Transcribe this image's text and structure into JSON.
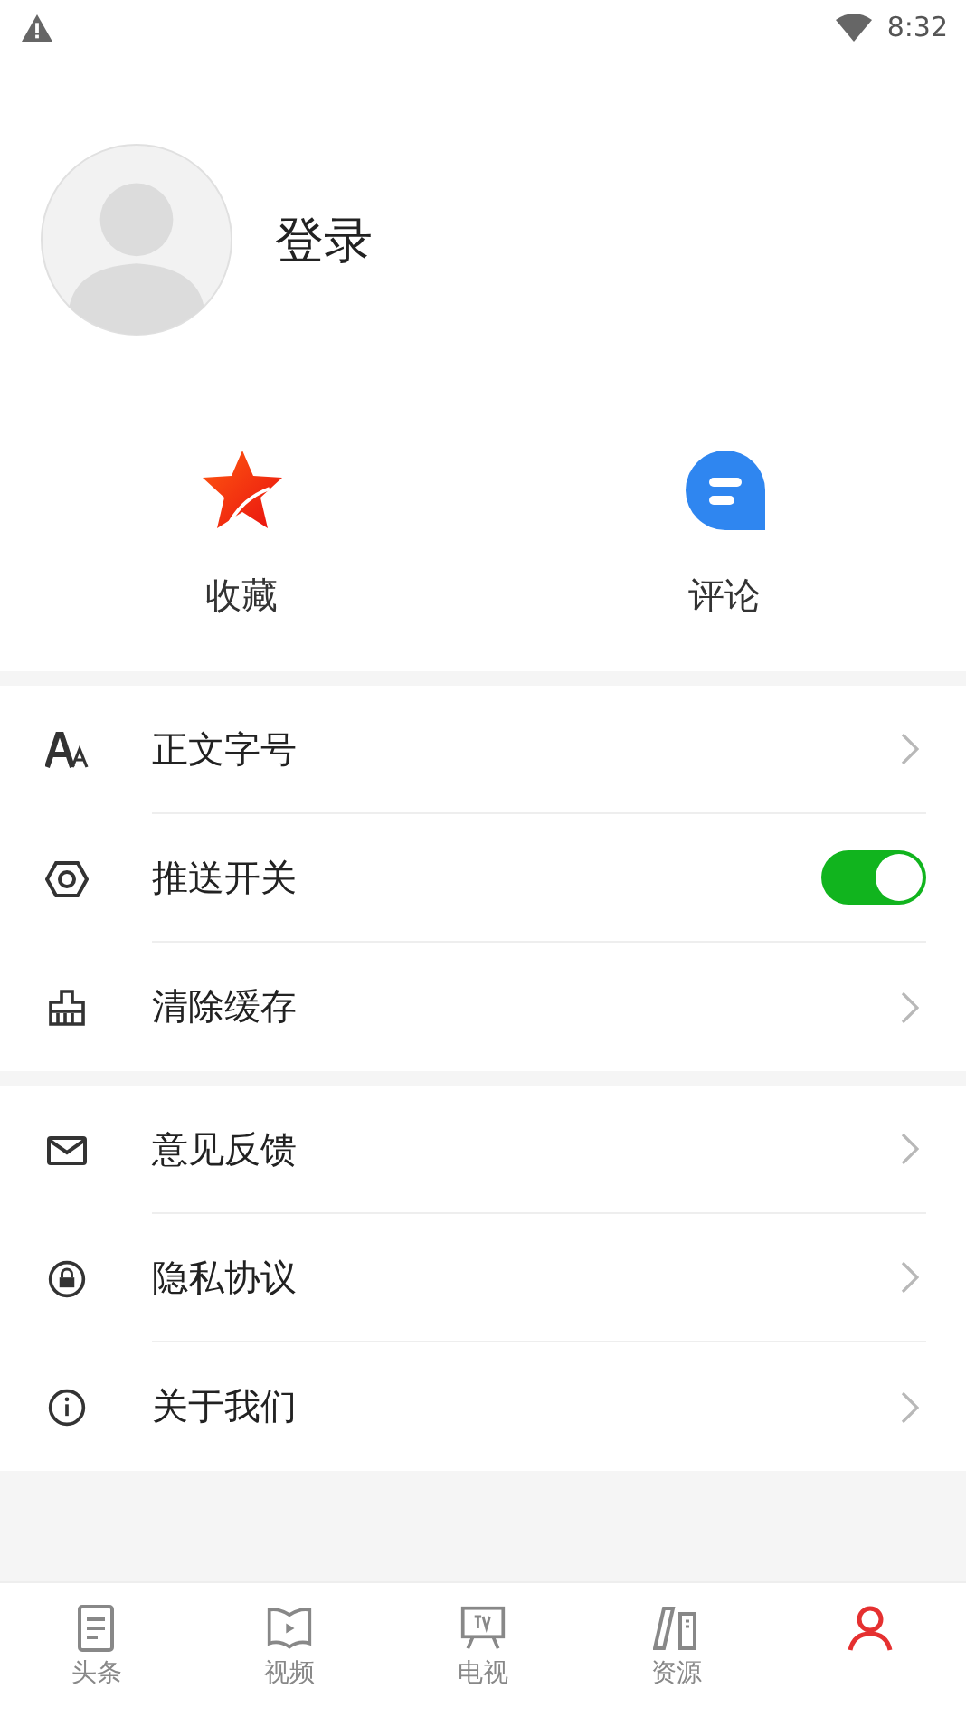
{
  "status_bar": {
    "time": "8:32"
  },
  "profile": {
    "login": "登录"
  },
  "shortcuts": [
    {
      "label": "收藏"
    },
    {
      "label": "评论"
    }
  ],
  "menu_groups": [
    [
      {
        "label": "正文字号",
        "kind": "arrow"
      },
      {
        "label": "推送开关",
        "kind": "toggle",
        "on": true
      },
      {
        "label": "清除缓存",
        "kind": "arrow"
      }
    ],
    [
      {
        "label": "意见反馈",
        "kind": "arrow"
      },
      {
        "label": "隐私协议",
        "kind": "arrow"
      },
      {
        "label": "关于我们",
        "kind": "arrow"
      }
    ]
  ],
  "tabs": [
    {
      "label": "头条",
      "selected": false
    },
    {
      "label": "视频",
      "selected": false
    },
    {
      "label": "电视",
      "selected": false
    },
    {
      "label": "资源",
      "selected": false
    },
    {
      "selected": true
    }
  ]
}
